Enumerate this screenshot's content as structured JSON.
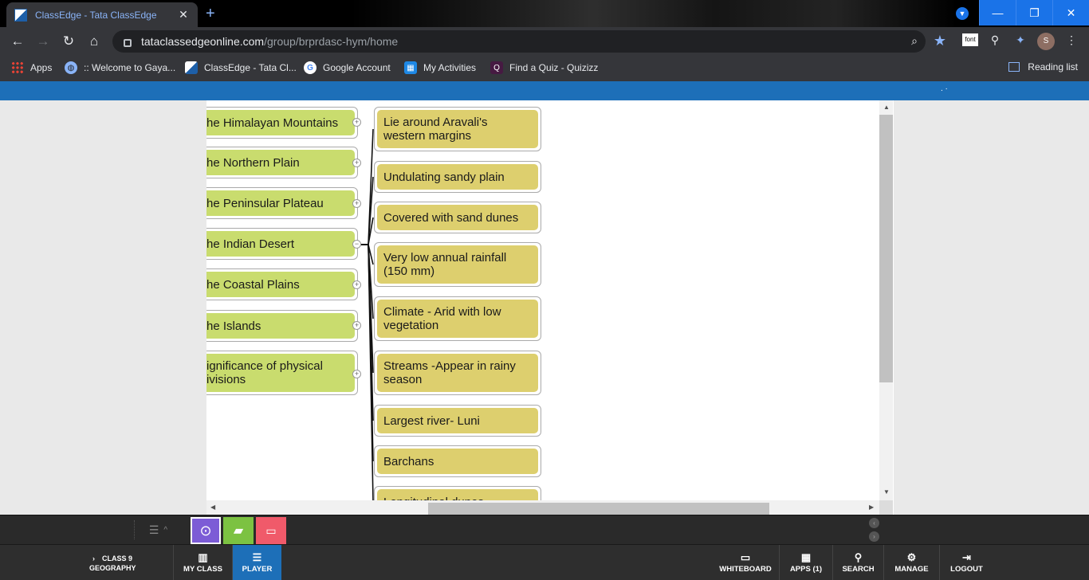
{
  "browser": {
    "tab_title": "ClassEdge - Tata ClassEdge",
    "tab_close": "✕",
    "new_tab": "+",
    "url_host": "tataclassedgeonline.com",
    "url_path": "/group/brprdasc-hym/home",
    "profile_initial": "S",
    "ext_font_label": "font",
    "bookmarks": [
      {
        "label": "Apps",
        "icon": "apps-grid-icon"
      },
      {
        "label": ":: Welcome to Gaya...",
        "icon": "globe-icon"
      },
      {
        "label": "ClassEdge - Tata Cl...",
        "icon": "classedge-icon"
      },
      {
        "label": "Google Account",
        "icon": "google-icon"
      },
      {
        "label": "My Activities",
        "icon": "my-activities-icon"
      },
      {
        "label": "Find a Quiz - Quizizz",
        "icon": "quizizz-icon"
      }
    ],
    "reading_list": "Reading list"
  },
  "mindmap": {
    "left_nodes": [
      {
        "label": "he Himalayan Mountains"
      },
      {
        "label": "he Northern Plain"
      },
      {
        "label": "he Peninsular Plateau"
      },
      {
        "label": "he Indian Desert"
      },
      {
        "label": "he Coastal Plains"
      },
      {
        "label": "he Islands"
      },
      {
        "label": "ignificance of physical\nivisions"
      }
    ],
    "right_nodes": [
      {
        "label": "Lie around Aravali's western margins"
      },
      {
        "label": "Undulating sandy plain"
      },
      {
        "label": "Covered with sand dunes"
      },
      {
        "label": "Very low annual rainfall (150 mm)"
      },
      {
        "label": "Climate - Arid with low vegetation"
      },
      {
        "label": "Streams -Appear in rainy season"
      },
      {
        "label": "Largest river- Luni"
      },
      {
        "label": "Barchans"
      },
      {
        "label": "Longitudinal dunes"
      }
    ],
    "expanded_node_index": 3
  },
  "footer": {
    "class_line1": "CLASS 9",
    "class_line2": "GEOGRAPHY",
    "items": [
      {
        "label": "MY CLASS",
        "icon": "books-icon"
      },
      {
        "label": "PLAYER",
        "icon": "player-icon"
      },
      {
        "label": "WHITEBOARD",
        "icon": "whiteboard-icon"
      },
      {
        "label": "APPS (1)",
        "icon": "apps-icon"
      },
      {
        "label": "SEARCH",
        "icon": "search-icon"
      },
      {
        "label": "MANAGE",
        "icon": "manage-icon"
      },
      {
        "label": "LOGOUT",
        "icon": "logout-icon"
      }
    ]
  },
  "colors": {
    "accent_blue": "#1d6fb8",
    "node_green": "#c9dc6e",
    "node_yellow": "#ddcf6e",
    "dock_purple": "#7c5cd6",
    "dock_green": "#7cc242",
    "dock_red": "#f05a6a"
  }
}
